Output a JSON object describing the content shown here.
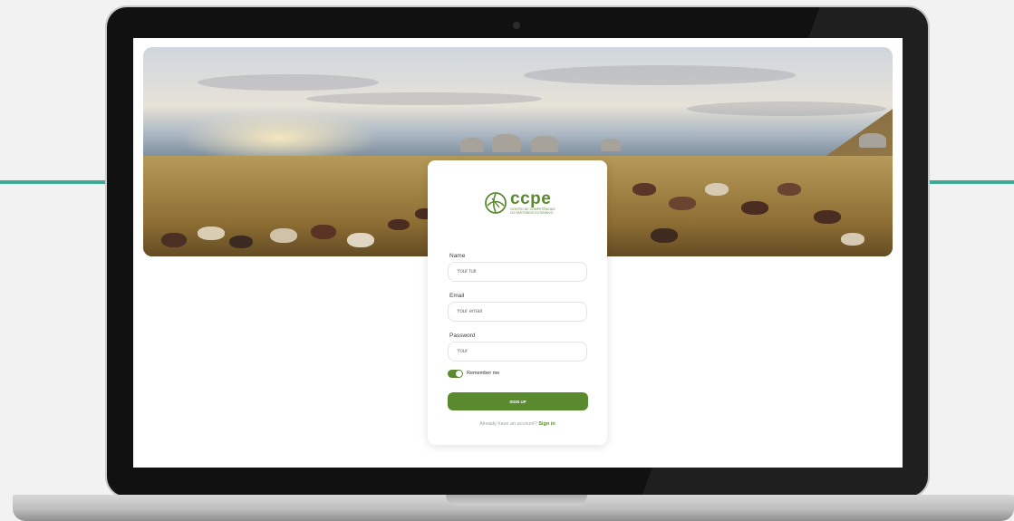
{
  "brand": {
    "logo_word": "ccpe",
    "logo_subtitle": "centro de competências do pastoreio extensivo",
    "accent_color": "#5a8a2e"
  },
  "form": {
    "name": {
      "label": "Name",
      "placeholder": "Your full"
    },
    "email": {
      "label": "Email",
      "placeholder": "Your email"
    },
    "password": {
      "label": "Password",
      "placeholder": "Your"
    },
    "remember": {
      "label": "Remember me",
      "checked": true
    },
    "submit_label": "SIGN UP",
    "footer_text": "Already have an account?",
    "footer_link": "Sign in"
  },
  "icons": {
    "logo": "ccpe-logo-icon",
    "camera": "camera-icon"
  }
}
